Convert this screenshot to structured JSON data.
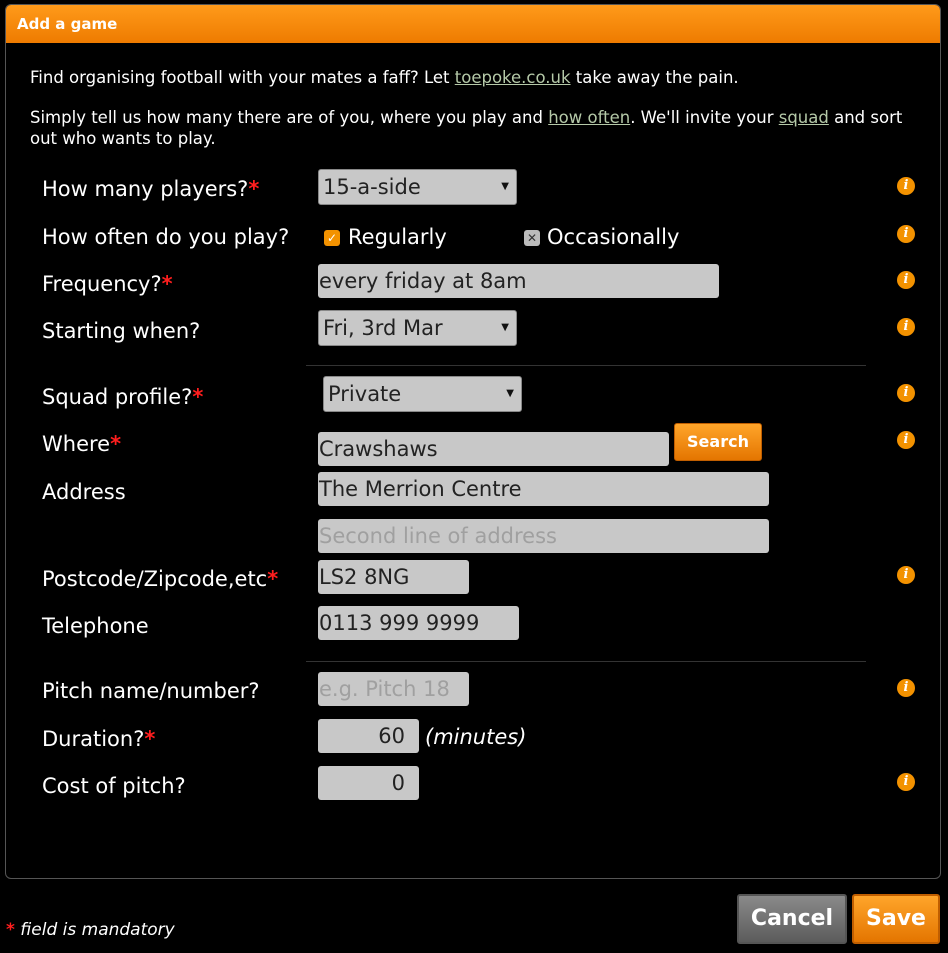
{
  "dialog": {
    "title": "Add a game",
    "intro1_pre": "Find organising football with your mates a faff? Let ",
    "intro1_link": "toepoke.co.uk",
    "intro1_post": " take away the pain.",
    "intro2_pre": "Simply tell us how many there are of you, where you play and ",
    "intro2_link1": "how often",
    "intro2_mid": ". We'll invite your ",
    "intro2_link2": "squad",
    "intro2_post": " and sort out who wants to play."
  },
  "form": {
    "players_label": "How many players?",
    "players_value": "15-a-side",
    "howoften_label": "How often do you play?",
    "regularly_label": "Regularly",
    "regularly_checked": true,
    "occasionally_label": "Occasionally",
    "occasionally_checked": false,
    "frequency_label": "Frequency?",
    "frequency_value": "every friday at 8am",
    "starting_label": "Starting when?",
    "starting_value": "Fri, 3rd Mar",
    "squad_label": "Squad profile?",
    "squad_value": "Private",
    "where_label": "Where",
    "where_value": "Crawshaws",
    "search_label": "Search",
    "address_label": "Address",
    "address1_value": "The Merrion Centre",
    "address2_placeholder": "Second line of address",
    "postcode_label": "Postcode/Zipcode,etc",
    "postcode_value": "LS2 8NG",
    "telephone_label": "Telephone",
    "telephone_value": "0113 999 9999",
    "pitch_label": "Pitch name/number?",
    "pitch_placeholder": "e.g. Pitch 18",
    "duration_label": "Duration?",
    "duration_value": "60",
    "duration_unit": "(minutes)",
    "cost_label": "Cost of pitch?",
    "cost_value": "0",
    "required_mark": "*",
    "info_glyph": "i"
  },
  "footer": {
    "mandatory_mark": "*",
    "mandatory_text": " field is mandatory",
    "cancel_label": "Cancel",
    "save_label": "Save"
  },
  "colors": {
    "accent": "#f39200",
    "required": "#ff1e1e",
    "field_bg": "#c8c8c8"
  }
}
